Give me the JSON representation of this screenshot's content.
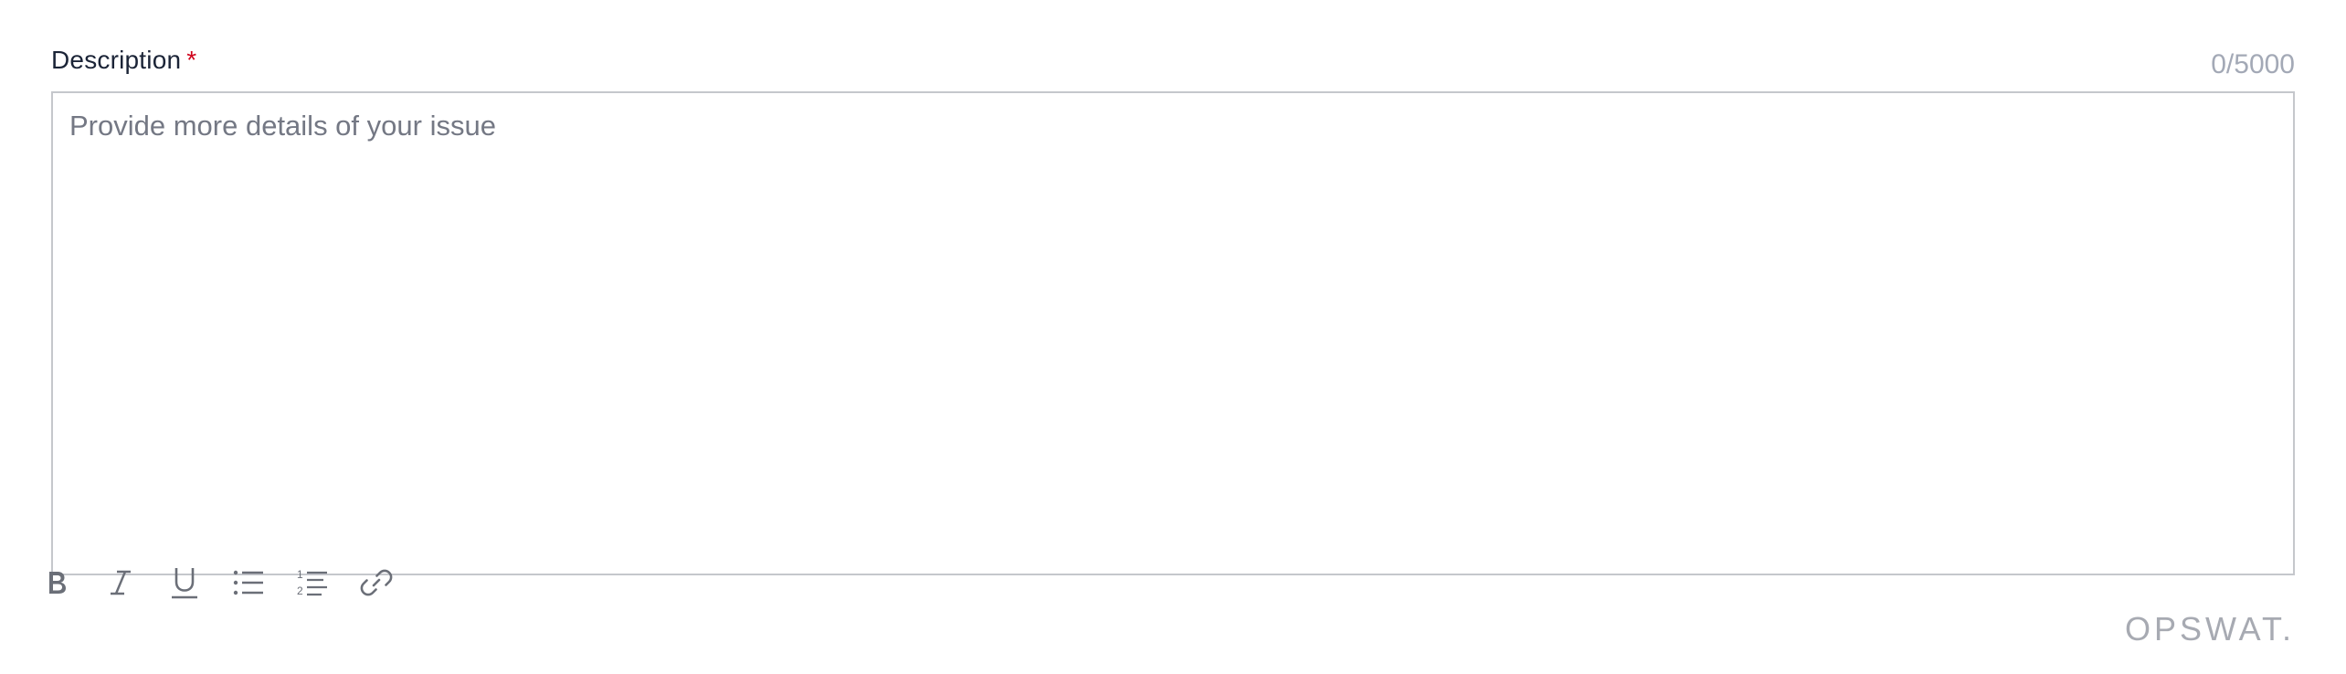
{
  "field": {
    "label": "Description",
    "required_mark": "*",
    "counter": "0/5000",
    "placeholder": "Provide more details of your issue",
    "value": ""
  },
  "toolbar": {
    "items": [
      {
        "name": "bold",
        "icon": "bold-icon"
      },
      {
        "name": "italic",
        "icon": "italic-icon"
      },
      {
        "name": "underline",
        "icon": "underline-icon"
      },
      {
        "name": "bulleted-list",
        "icon": "bulleted-list-icon"
      },
      {
        "name": "numbered-list",
        "icon": "numbered-list-icon"
      },
      {
        "name": "link",
        "icon": "link-icon"
      }
    ]
  },
  "brand": {
    "text": "OPSWAT."
  },
  "colors": {
    "label": "#1b2437",
    "required": "#d0021b",
    "counter": "#a3a9b6",
    "border": "#c5c7cc",
    "placeholder": "#747884",
    "icon": "#6b6f78",
    "brand": "#a7aab2"
  }
}
